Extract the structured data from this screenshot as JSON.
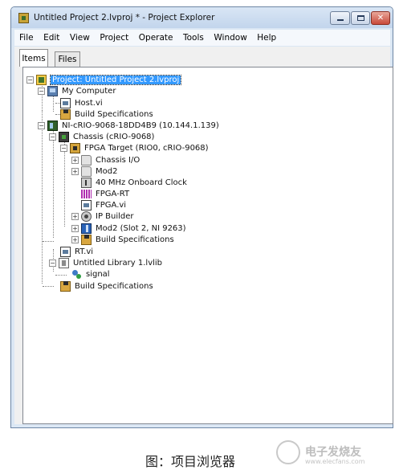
{
  "window": {
    "title": "Untitled Project 2.lvproj * - Project Explorer"
  },
  "menu": [
    "File",
    "Edit",
    "View",
    "Project",
    "Operate",
    "Tools",
    "Window",
    "Help"
  ],
  "tabs": [
    "Items",
    "Files"
  ],
  "tree": {
    "root": "Project: Untitled Project 2.lvproj",
    "my_computer": "My Computer",
    "host_vi": "Host.vi",
    "mc_build_specs": "Build Specifications",
    "crio_target": "NI-cRIO-9068-18DD4B9 (10.144.1.139)",
    "chassis": "Chassis (cRIO-9068)",
    "fpga_target": "FPGA Target (RIO0, cRIO-9068)",
    "chassis_io": "Chassis I/O",
    "mod2_folder": "Mod2",
    "onboard_clock": "40 MHz Onboard Clock",
    "fpga_rt": "FPGA-RT",
    "fpga_vi": "FPGA.vi",
    "ip_builder": "IP Builder",
    "mod2_module": "Mod2 (Slot 2, NI 9263)",
    "fpga_build_specs": "Build Specifications",
    "rt_vi": "RT.vi",
    "library": "Untitled Library 1.lvlib",
    "signal": "signal",
    "crio_build_specs": "Build Specifications"
  },
  "icons": {
    "root": "project-icon",
    "my_computer": "computer-icon",
    "vi": "vi-icon",
    "build": "build-spec-icon",
    "target": "crio-target-icon",
    "chassis": "chassis-icon",
    "fpga": "fpga-target-icon",
    "folder": "folder-icon",
    "clock": "clock-icon",
    "fpga_rt": "fifo-icon",
    "ip_builder": "ip-builder-icon",
    "module": "module-icon",
    "library": "library-icon",
    "signal": "shared-variable-icon"
  },
  "colors": {
    "selection": "#3399ff",
    "title_bar": "#c2d5ec",
    "close_button": "#c8493a"
  },
  "caption": "图：项目浏览器",
  "watermark": {
    "text": "电子发烧友",
    "url": "www.elecfans.com"
  }
}
